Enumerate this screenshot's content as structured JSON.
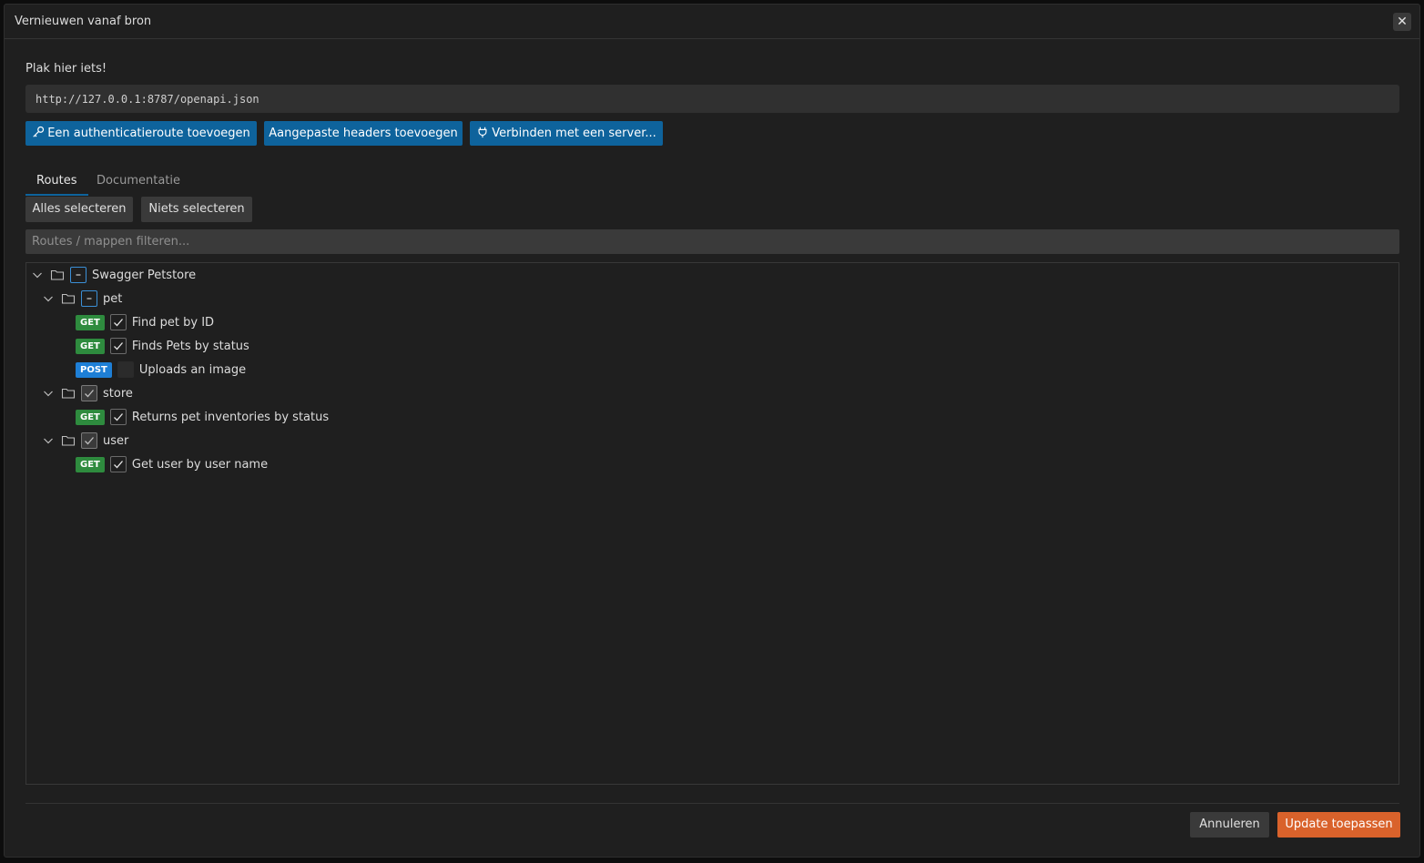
{
  "window": {
    "title": "Vernieuwen vanaf bron",
    "close_label": "✕"
  },
  "source": {
    "label": "Plak hier iets!",
    "url_value": "http://127.0.0.1:8787/openapi.json"
  },
  "actions": {
    "add_auth_route": "Een authenticatieroute toevoegen",
    "add_custom_headers": "Aangepaste headers toevoegen",
    "connect_server": "Verbinden met een server..."
  },
  "tabs": [
    {
      "label": "Routes",
      "active": true
    },
    {
      "label": "Documentatie",
      "active": false
    }
  ],
  "selection": {
    "select_all": "Alles selecteren",
    "select_none": "Niets selecteren"
  },
  "filter": {
    "placeholder": "Routes / mappen filteren..."
  },
  "tree": {
    "root": {
      "label": "Swagger Petstore",
      "state": "partial"
    },
    "folders": [
      {
        "label": "pet",
        "state": "partial",
        "routes": [
          {
            "method": "GET",
            "label": "Find pet by ID",
            "checked": true
          },
          {
            "method": "GET",
            "label": "Finds Pets by status",
            "checked": true
          },
          {
            "method": "POST",
            "label": "Uploads an image",
            "checked": false
          }
        ]
      },
      {
        "label": "store",
        "state": "checked",
        "routes": [
          {
            "method": "GET",
            "label": "Returns pet inventories by status",
            "checked": true
          }
        ]
      },
      {
        "label": "user",
        "state": "checked",
        "routes": [
          {
            "method": "GET",
            "label": "Get user by user name",
            "checked": true
          }
        ]
      }
    ]
  },
  "footer": {
    "cancel": "Annuleren",
    "apply": "Update toepassen"
  },
  "colors": {
    "primary_blue": "#0e639c",
    "apply_orange": "#d9622b",
    "get_green": "#2e8b3e",
    "post_blue": "#1e7fd6",
    "background": "#1f1f1f"
  }
}
